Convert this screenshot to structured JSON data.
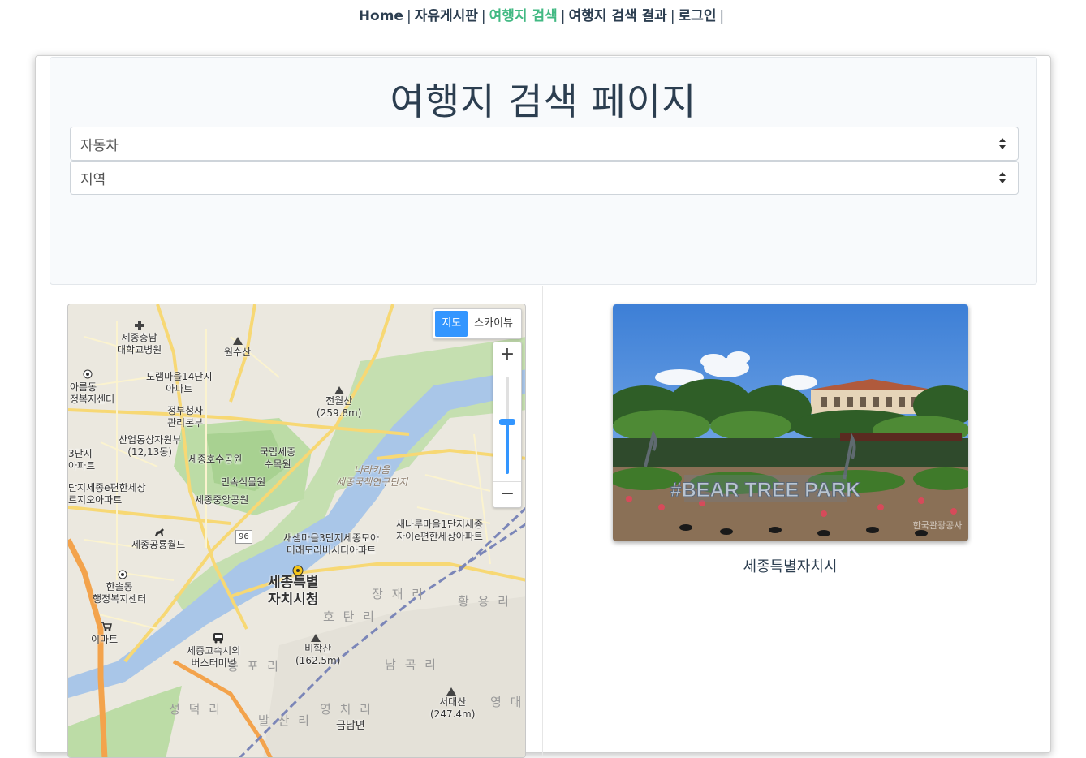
{
  "nav": {
    "items": [
      {
        "label": "Home",
        "active": false
      },
      {
        "label": "자유게시판",
        "active": false
      },
      {
        "label": "여행지 검색",
        "active": true
      },
      {
        "label": "여행지 검색 결과",
        "active": false
      },
      {
        "label": "로그인",
        "active": false
      }
    ],
    "separator": "|",
    "active_color": "#42b983"
  },
  "search": {
    "title": "여행지 검색 페이지",
    "transport_select": {
      "value": "자동차"
    },
    "region_select": {
      "value": "지역"
    }
  },
  "map": {
    "type_buttons": {
      "map": "지도",
      "skyview": "스카이뷰",
      "selected": "지도"
    },
    "zoom_in": "+",
    "zoom_out": "−",
    "zoom_level_fraction": 0.5,
    "labels": {
      "hospital": "세종충남\n대학교병원",
      "wonsusan": "원수산",
      "dorammaeul": "도램마을14단지\n아파트",
      "areumdong": "아름동\n정복지센터",
      "jeonwolsan": "전월산\n(259.8m)",
      "govt_complex": "정부청사\n관리본부",
      "industry": "산업통상자원부\n(12,13동)",
      "lake_park": "세종호수공원",
      "arboretum": "국립세종\n수목원",
      "narakium": "나라키움\n세종국책연구단지",
      "apt1": "3단지\n아파트",
      "apt2": "단지세종e편한세상\n르지오아파트",
      "folk_museum": "민속식물원",
      "central_park": "세종중앙공원",
      "world": "세종공룡월드",
      "road96": "96",
      "saesam": "새샘마을3단지세종모아\n미래도리버시티아파트",
      "sanaru": "새나루마을1단지세종\n자이e편한세상아파트",
      "city_hall": "세종특별\n자치시청",
      "hansoldong": "한솔동\n행정복지센터",
      "emart": "이마트",
      "express": "세종고속시외\n버스터미널",
      "bihaksan": "비학산\n(162.5m)",
      "seodaesan": "서대산\n(247.4m)",
      "jangjae": "장 재 리",
      "hwangyong": "황 용 리",
      "hotan": "호 탄 리",
      "namgok": "남 곡 리",
      "yongpo": "용 포 리",
      "yeongchi": "영 치 리",
      "geumnam": "금남면",
      "seongdeok": "성 덕 리",
      "balsan": "발 산 리",
      "yeongdae": "영 대 리"
    }
  },
  "result": {
    "photo_sign": "#BEAR TREE PARK",
    "photo_watermark": "한국관광공사",
    "caption": "세종특별자치시"
  }
}
